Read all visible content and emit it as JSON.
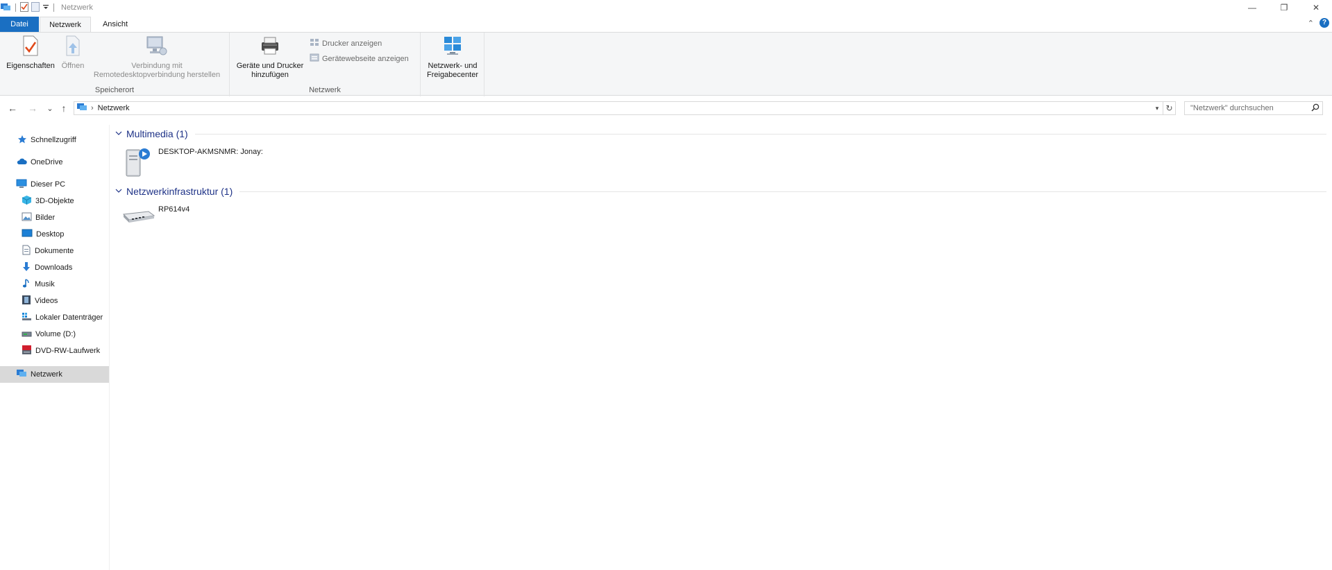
{
  "window": {
    "title": "Netzwerk",
    "minimize_glyph": "—",
    "restore_glyph": "❐",
    "close_glyph": "✕"
  },
  "ribbon_tabs": {
    "file": "Datei",
    "network": "Netzwerk",
    "view": "Ansicht",
    "help": "?",
    "collapse_glyph": "⌃"
  },
  "ribbon": {
    "location_group": {
      "label": "Speicherort",
      "properties": "Eigenschaften",
      "open": "Öffnen",
      "remote_line1": "Verbindung mit",
      "remote_line2": "Remotedesktopverbindung herstellen"
    },
    "network_group": {
      "label": "Netzwerk",
      "add_devices_line1": "Geräte und Drucker",
      "add_devices_line2": "hinzufügen",
      "show_printers": "Drucker anzeigen",
      "device_webpage": "Gerätewebseite anzeigen"
    },
    "center_group": {
      "center_line1": "Netzwerk- und",
      "center_line2": "Freigabecenter"
    }
  },
  "navigation": {
    "back": "←",
    "forward": "→",
    "recent": "⌄",
    "up": "↑",
    "breadcrumb_sep": "›",
    "address_crumb": "Netzwerk",
    "refresh": "↻",
    "search_placeholder": "\"Netzwerk\" durchsuchen"
  },
  "sidebar": {
    "items": [
      {
        "label": "Schnellzugriff"
      },
      {
        "label": "OneDrive"
      },
      {
        "label": "Dieser PC"
      },
      {
        "label": "3D-Objekte"
      },
      {
        "label": "Bilder"
      },
      {
        "label": "Desktop"
      },
      {
        "label": "Dokumente"
      },
      {
        "label": "Downloads"
      },
      {
        "label": "Musik"
      },
      {
        "label": "Videos"
      },
      {
        "label": "Lokaler Datenträger"
      },
      {
        "label": "Volume (D:)"
      },
      {
        "label": "DVD-RW-Laufwerk"
      },
      {
        "label": "Netzwerk"
      }
    ]
  },
  "content": {
    "groups": [
      {
        "title": "Multimedia (1)",
        "items": [
          {
            "name": "DESKTOP-AKMSNMR: Jonay:"
          }
        ]
      },
      {
        "title": "Netzwerkinfrastruktur (1)",
        "items": [
          {
            "name": "RP614v4"
          }
        ]
      }
    ]
  },
  "colors": {
    "accent": "#1a6fc2",
    "group_heading": "#1e3287",
    "selected_bg": "#d9d9d9",
    "ribbon_bg": "#f5f6f7"
  }
}
